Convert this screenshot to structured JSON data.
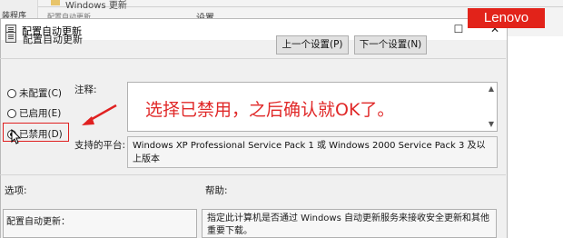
{
  "background": {
    "left_text_1": "装程序",
    "left_text_2": "",
    "title": "Windows 更新",
    "sub_1": "配置自动更新",
    "sub_2": "设置"
  },
  "dialog": {
    "title": "配置自动更新",
    "header": "配置自动更新",
    "prev_button": "上一个设置(P)",
    "next_button": "下一个设置(N)",
    "radio_not_configured": "未配置(C)",
    "radio_enabled": "已启用(E)",
    "radio_disabled": "已禁用(D)",
    "selected": "disabled",
    "comment_label": "注释:",
    "platform_label": "支持的平台:",
    "platform_text": "Windows XP Professional Service Pack 1 或 Windows 2000 Service Pack 3 及以上版本",
    "options_label": "选项:",
    "help_label": "帮助:",
    "options_content": "配置自动更新：",
    "help_content": "指定此计算机是否通过 Windows 自动更新服务来接收安全更新和其他重要下载。"
  },
  "annotation": "选择已禁用，之后确认就OK了。",
  "brand": "Lenovo",
  "colors": {
    "annotation": "#e02828",
    "brand": "#e2231a"
  }
}
